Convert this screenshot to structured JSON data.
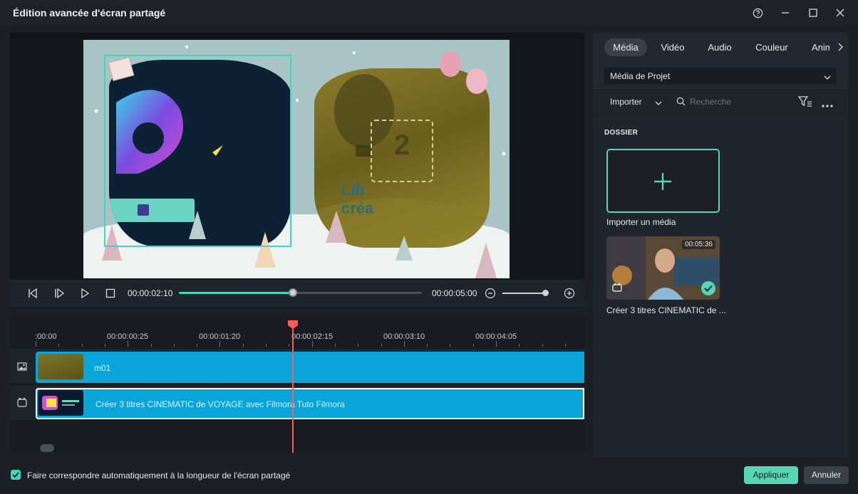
{
  "window": {
    "title": "Édition avancée d'écran partagé"
  },
  "preview": {
    "overlay_text_1": "Lib",
    "overlay_text_2": "créa",
    "drop_placeholder_number": "2"
  },
  "playback": {
    "current_time": "00:00:02:10",
    "total_time": "00:00:05:00",
    "progress_fraction": 0.47,
    "zoom_fraction": 0.9
  },
  "timeline": {
    "ruler": [
      ":00:00",
      "00:00:00:25",
      "00:00:01:20",
      "00:00:02:15",
      "00:00:03:10",
      "00:00:04:05"
    ],
    "tracks": [
      {
        "label": "m01"
      },
      {
        "label": "Créer 3 titres CINEMATIC de VOYAGE avec Filmora  Tuto Filmora"
      }
    ]
  },
  "right_panel": {
    "tabs": [
      "Média",
      "Vidéo",
      "Audio",
      "Couleur",
      "Anim"
    ],
    "active_tab": "Média",
    "source_select": "Média de Projet",
    "import_label": "Importer",
    "search_placeholder": "Recherche",
    "section_title": "DOSSIER",
    "import_tile_caption": "Importer un média",
    "media_item": {
      "caption": "Créer 3 titres CINEMATIC de ...",
      "duration": "00:05:36"
    }
  },
  "footer": {
    "auto_match_label": "Faire correspondre automatiquement à la longueur de l'écran partagé",
    "apply_label": "Appliquer",
    "cancel_label": "Annuler"
  },
  "colors": {
    "accent": "#56d6b5",
    "clip": "#0aa5d8",
    "playhead": "#ff5a5a"
  }
}
